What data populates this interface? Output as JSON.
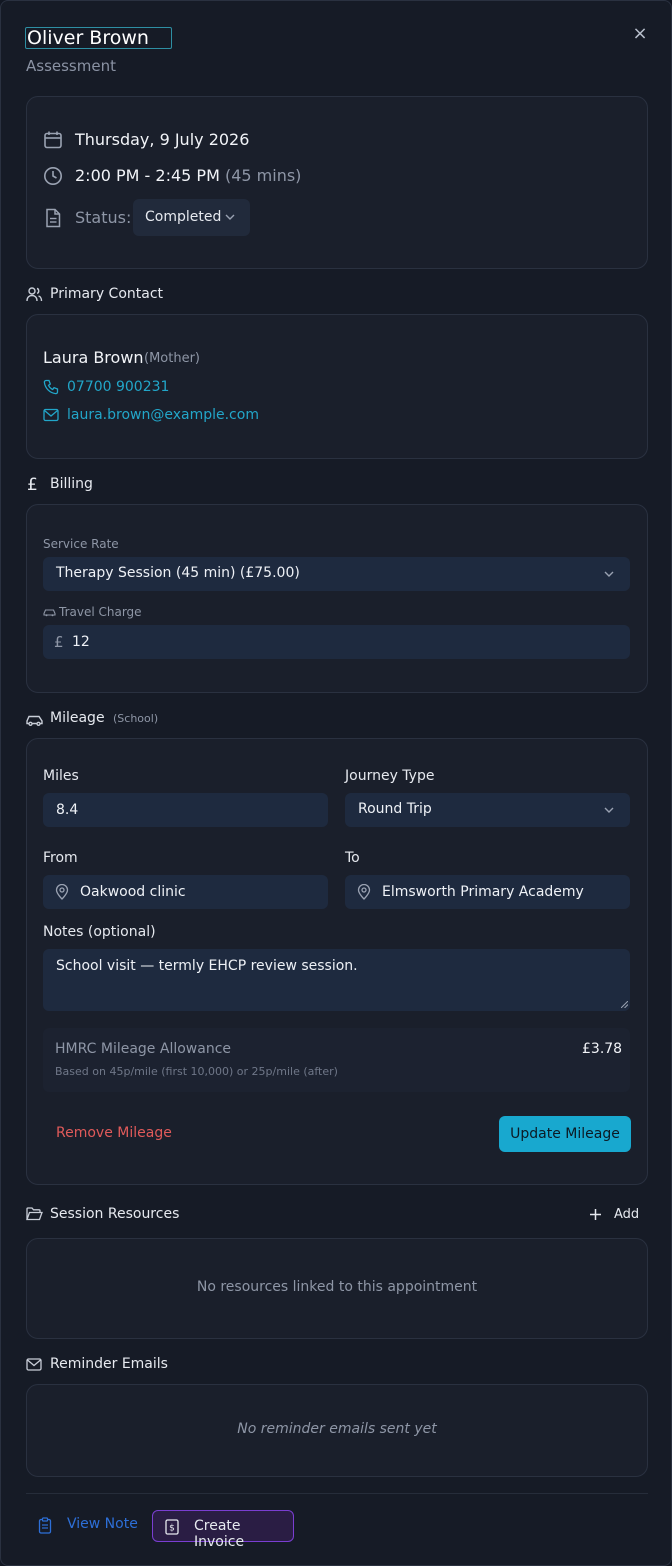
{
  "header": {
    "title": "Oliver Brown",
    "subtitle": "Assessment",
    "close": "×"
  },
  "appointment": {
    "date": "Thursday, 9 July 2026",
    "time": "2:00 PM - 2:45 PM",
    "duration": "(45 mins)",
    "status_label": "Status:",
    "status_value": "Completed"
  },
  "primary_contact": {
    "heading": "Primary Contact",
    "name": "Laura Brown",
    "relation": "(Mother)",
    "phone": "07700 900231",
    "email": "laura.brown@example.com"
  },
  "billing": {
    "heading": "Billing",
    "service_rate_label": "Service Rate",
    "service_rate_value": "Therapy Session (45 min) (£75.00)",
    "travel_charge_label": "Travel Charge",
    "currency_symbol": "£",
    "travel_charge_value": "12"
  },
  "mileage": {
    "heading": "Mileage",
    "tag": "(School)",
    "miles_label": "Miles",
    "miles_value": "8.4",
    "journey_label": "Journey Type",
    "journey_value": "Round Trip",
    "from_label": "From",
    "from_value": "Oakwood clinic",
    "to_label": "To",
    "to_value": "Elmsworth Primary Academy",
    "notes_label": "Notes (optional)",
    "notes_value": "School visit — termly EHCP review session.",
    "allowance_title": "HMRC Mileage Allowance",
    "allowance_note": "Based on 45p/mile (first 10,000) or 25p/mile (after)",
    "allowance_amount": "£3.78",
    "remove_label": "Remove Mileage",
    "update_label": "Update Mileage"
  },
  "resources": {
    "heading": "Session Resources",
    "add_label": "Add",
    "empty_text": "No resources linked to this appointment"
  },
  "reminders": {
    "heading": "Reminder Emails",
    "empty_text": "No reminder emails sent yet"
  },
  "footer": {
    "view_note_label": "View Note",
    "create_invoice_label": "Create Invoice"
  },
  "colors": {
    "accent": "#18a8cf",
    "link": "#22a6c9",
    "danger": "#e05a5a",
    "invoice_border": "#7a3ed1"
  }
}
